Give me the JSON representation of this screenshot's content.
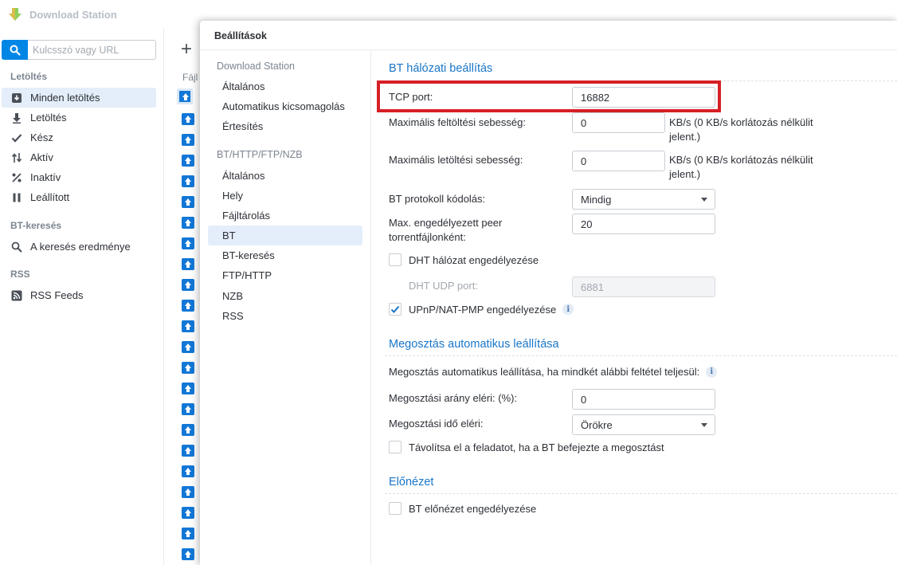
{
  "app": {
    "title": "Download Station"
  },
  "sidebar": {
    "search_placeholder": "Kulcsszó vagy URL",
    "sections": [
      {
        "header": "Letöltés",
        "items": [
          {
            "label": "Minden letöltés",
            "icon": "download-box-icon",
            "active": true
          },
          {
            "label": "Letöltés",
            "icon": "arrow-down-icon"
          },
          {
            "label": "Kész",
            "icon": "checkmark-icon"
          },
          {
            "label": "Aktív",
            "icon": "up-down-arrows-icon"
          },
          {
            "label": "Inaktív",
            "icon": "percent-icon"
          },
          {
            "label": "Leállított",
            "icon": "pause-icon"
          }
        ]
      },
      {
        "header": "BT-keresés",
        "items": [
          {
            "label": "A keresés eredménye",
            "icon": "search-icon"
          }
        ]
      },
      {
        "header": "RSS",
        "items": [
          {
            "label": "RSS Feeds",
            "icon": "rss-icon"
          }
        ]
      }
    ]
  },
  "list": {
    "add_label": "+",
    "header": "Fájl"
  },
  "dialog": {
    "title": "Beállítások",
    "nav": {
      "group1": {
        "header": "Download Station",
        "items": [
          "Általános",
          "Automatikus kicsomagolás",
          "Értesítés"
        ]
      },
      "group2": {
        "header": "BT/HTTP/FTP/NZB",
        "items": [
          "Általános",
          "Hely",
          "Fájltárolás",
          "BT",
          "BT-keresés",
          "FTP/HTTP",
          "NZB",
          "RSS"
        ]
      },
      "active": "BT"
    },
    "bt_network": {
      "title": "BT hálózati beállítás",
      "tcp_port_label": "TCP port:",
      "tcp_port_value": "16882",
      "max_upload_label": "Maximális feltöltési sebesség:",
      "max_upload_value": "0",
      "max_upload_unit": "KB/s (0 KB/s korlátozás nélkülit jelent.)",
      "max_download_label": "Maximális letöltési sebesség:",
      "max_download_value": "0",
      "max_download_unit": "KB/s (0 KB/s korlátozás nélkülit jelent.)",
      "protocol_label": "BT protokoll kódolás:",
      "protocol_value": "Mindig",
      "max_peer_label": "Max. engedélyezett peer torrentfájlonként:",
      "max_peer_value": "20",
      "dht_label": "DHT hálózat engedélyezése",
      "dht_checked": false,
      "dht_port_label": "DHT UDP port:",
      "dht_port_value": "6881",
      "upnp_label": "UPnP/NAT-PMP engedélyezése",
      "upnp_checked": true
    },
    "share_stop": {
      "title": "Megosztás automatikus leállítása",
      "condition_text": "Megosztás automatikus leállítása, ha mindkét alábbi feltétel teljesül:",
      "ratio_label": "Megosztási arány eléri: (%):",
      "ratio_value": "0",
      "time_label": "Megosztási idő eléri:",
      "time_value": "Örökre",
      "remove_label": "Távolítsa el a feladatot, ha a BT befejezte a megosztást",
      "remove_checked": false
    },
    "preview": {
      "title": "Előnézet",
      "enable_label": "BT előnézet engedélyezése",
      "enable_checked": false
    }
  },
  "colors": {
    "accent": "#0086e5",
    "section_title": "#1a76c8",
    "highlight": "#d61f26",
    "active_bg": "#e4eefa"
  }
}
